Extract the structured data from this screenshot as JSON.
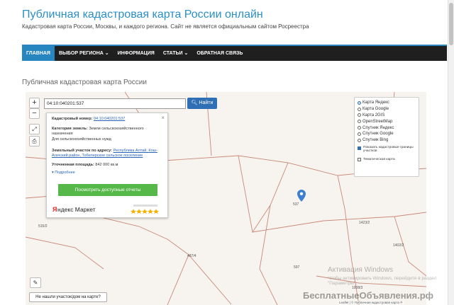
{
  "header": {
    "title": "Публичная кадастровая карта России онлайн",
    "subtitle": "Кадастровая карта России, Москвы, и каждого региона. Сайт не является официальным сайтом Росреестра"
  },
  "nav": {
    "items": [
      {
        "label": "ГЛАВНАЯ",
        "active": true
      },
      {
        "label": "ВЫБОР РЕГИОНА ⌄",
        "active": false
      },
      {
        "label": "ИНФОРМАЦИЯ",
        "active": false
      },
      {
        "label": "СТАТЬИ ⌄",
        "active": false
      },
      {
        "label": "ОБРАТНАЯ СВЯЗЬ",
        "active": false
      }
    ]
  },
  "section_title": "Публичная кадастровая карта России",
  "map": {
    "zoom_in": "+",
    "zoom_out": "−",
    "search": {
      "value": "04:10:040201:537",
      "button": "Найти"
    },
    "popup": {
      "cadastral_label": "Кадастровый номер:",
      "cadastral_value": "04:10:040201:537",
      "category_label": "Категория земель:",
      "category_value": "Земли сельскохозяйственного назначения",
      "usage_value": "Для сельскохозяйственных нужд",
      "address_label": "Земельный участок по адресу:",
      "address_value": "Республика Алтай, Кош-Агачский район, Тобелерское сельское поселение",
      "area_label": "Уточненная площадь:",
      "area_value": "842 000 кв.м",
      "more": "▾ Подробнее",
      "button": "Посмотреть доступные отчеты",
      "close": "×"
    },
    "layers": {
      "options": [
        {
          "label": "Карта Яндекс",
          "selected": true
        },
        {
          "label": "Карта Google",
          "selected": false
        },
        {
          "label": "Карта 2GIS",
          "selected": false
        },
        {
          "label": "OpenStreetMap",
          "selected": false
        },
        {
          "label": "Спутник Яндекс",
          "selected": false
        },
        {
          "label": "Спутник Google",
          "selected": false
        },
        {
          "label": "Спутник Bing",
          "selected": false
        }
      ],
      "checkboxes": [
        {
          "label": "Показать кадастровые границы участков",
          "checked": true
        },
        {
          "label": "Тематическая карта",
          "checked": false
        }
      ]
    },
    "parcel_labels": [
      "537",
      "1423/2",
      "1402/2",
      "487/4",
      "597",
      "1008/3",
      "515/2"
    ],
    "not_found_button": "Не нашли участок/дом на карте?",
    "attribution": "Leaflet | © Публичная кадастровая карта ®",
    "watermark_activate": "Активация Windows",
    "watermark_activate_sub": "Чтобы активировать Windows, перейдите в раздел \"Параметры\".",
    "site_watermark": "БесплатныеОбъявления.рф"
  },
  "colors": {
    "title": "#2a8fc7",
    "nav_bg": "#1f1f1f",
    "nav_active": "#2786bf",
    "search_button": "#2f6fb6",
    "popup_button": "#55b848",
    "parcel_line": "#c98a7a",
    "marker": "#3b7fd1"
  }
}
